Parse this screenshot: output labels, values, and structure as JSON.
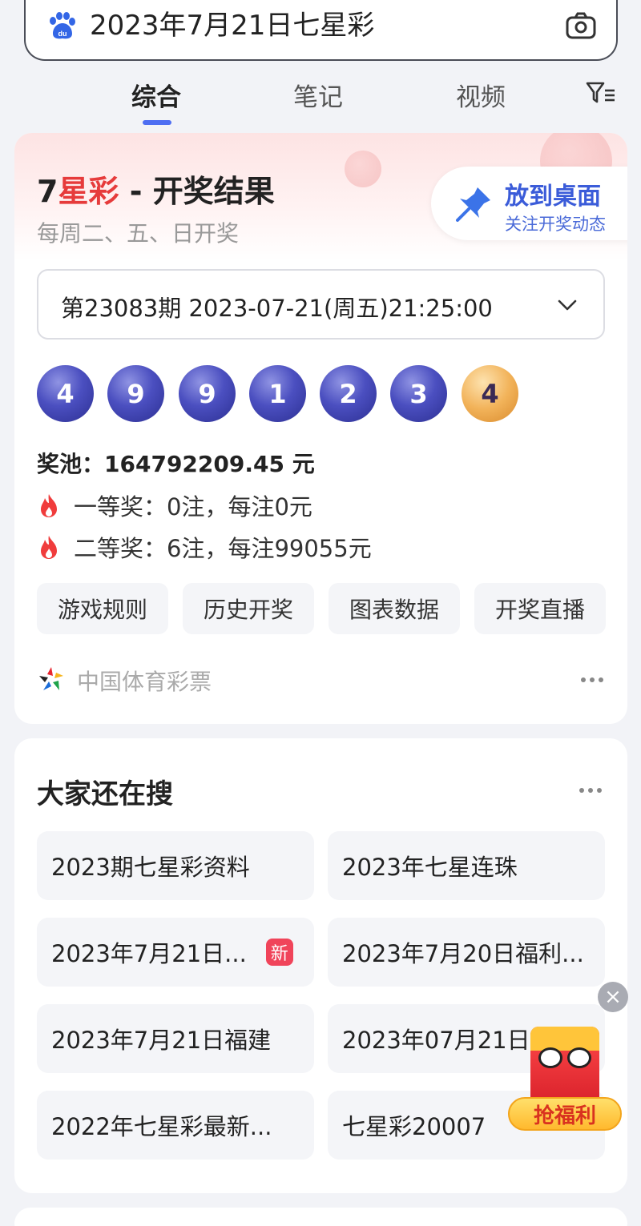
{
  "search": {
    "query": "2023年7月21日七星彩",
    "logo_icon": "baidu-paw-icon",
    "camera_icon": "camera-icon"
  },
  "tabs": [
    {
      "label": "综合",
      "active": true
    },
    {
      "label": "笔记",
      "active": false
    },
    {
      "label": "视频",
      "active": false
    }
  ],
  "filter_icon": "filter-icon",
  "result_card": {
    "title_prefix": "7",
    "title_red": "星彩",
    "title_suffix": " - 开奖结果",
    "subtitle": "每周二、五、日开奖",
    "pin": {
      "title": "放到桌面",
      "subtitle": "关注开奖动态"
    },
    "issue": "第23083期 2023-07-21(周五)21:25:00",
    "numbers": [
      {
        "value": "4",
        "color": "blue"
      },
      {
        "value": "9",
        "color": "blue"
      },
      {
        "value": "9",
        "color": "blue"
      },
      {
        "value": "1",
        "color": "blue"
      },
      {
        "value": "2",
        "color": "blue"
      },
      {
        "value": "3",
        "color": "blue"
      },
      {
        "value": "4",
        "color": "orange"
      }
    ],
    "pool_label": "奖池：",
    "pool_value": "164792209.45 元",
    "prizes": [
      {
        "text": "一等奖：0注，每注0元"
      },
      {
        "text": "二等奖：6注，每注99055元"
      }
    ],
    "actions": [
      "游戏规则",
      "历史开奖",
      "图表数据",
      "开奖直播"
    ],
    "source": "中国体育彩票"
  },
  "related": {
    "heading": "大家还在搜",
    "items": [
      {
        "label": "2023期七星彩资料"
      },
      {
        "label": "2023年七星连珠"
      },
      {
        "label": "2023年7月21日...",
        "badge": "新"
      },
      {
        "label": "2023年7月20日福利..."
      },
      {
        "label": "2023年7月21日福建"
      },
      {
        "label": "2023年07月21日"
      },
      {
        "label": "2022年七星彩最新..."
      },
      {
        "label": "七星彩20007"
      }
    ]
  },
  "float_ad": {
    "label": "抢福利",
    "close": "×"
  },
  "colors": {
    "accent": "#4e6ef2",
    "red": "#e63b3b",
    "ball_blue": "#3b3fa8",
    "ball_orange": "#f2b35a"
  }
}
